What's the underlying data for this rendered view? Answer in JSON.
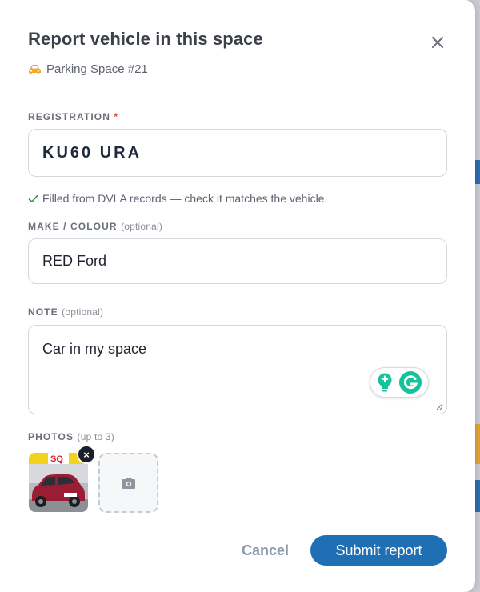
{
  "modal": {
    "title": "Report vehicle in this space",
    "subtitle": "Parking Space #21"
  },
  "registration": {
    "label": "REGISTRATION",
    "required_mark": "*",
    "value": "KU60 URA",
    "hint": "Filled from DVLA records — check it matches the vehicle."
  },
  "make_colour": {
    "label": "MAKE / COLOUR",
    "optional": "(optional)",
    "value": "RED Ford"
  },
  "note": {
    "label": "NOTE",
    "optional": "(optional)",
    "value": "Car in my space"
  },
  "photos": {
    "label": "PHOTOS",
    "limit": "(up to 3)",
    "count": 1,
    "thumb_sign_text": "SQ",
    "remove_glyph": "×"
  },
  "actions": {
    "cancel": "Cancel",
    "submit": "Submit report"
  },
  "icons": {
    "close": "close-icon",
    "car": "car-icon",
    "check": "check-icon",
    "camera": "camera-icon",
    "grammarly": "grammarly-icon",
    "lightbulb": "lightbulb-icon"
  },
  "colors": {
    "accent": "#1f6fb5",
    "car_icon": "#f0a92a",
    "check": "#3a9b4a",
    "required": "#e04a3f",
    "grammarly": "#15c39a"
  }
}
